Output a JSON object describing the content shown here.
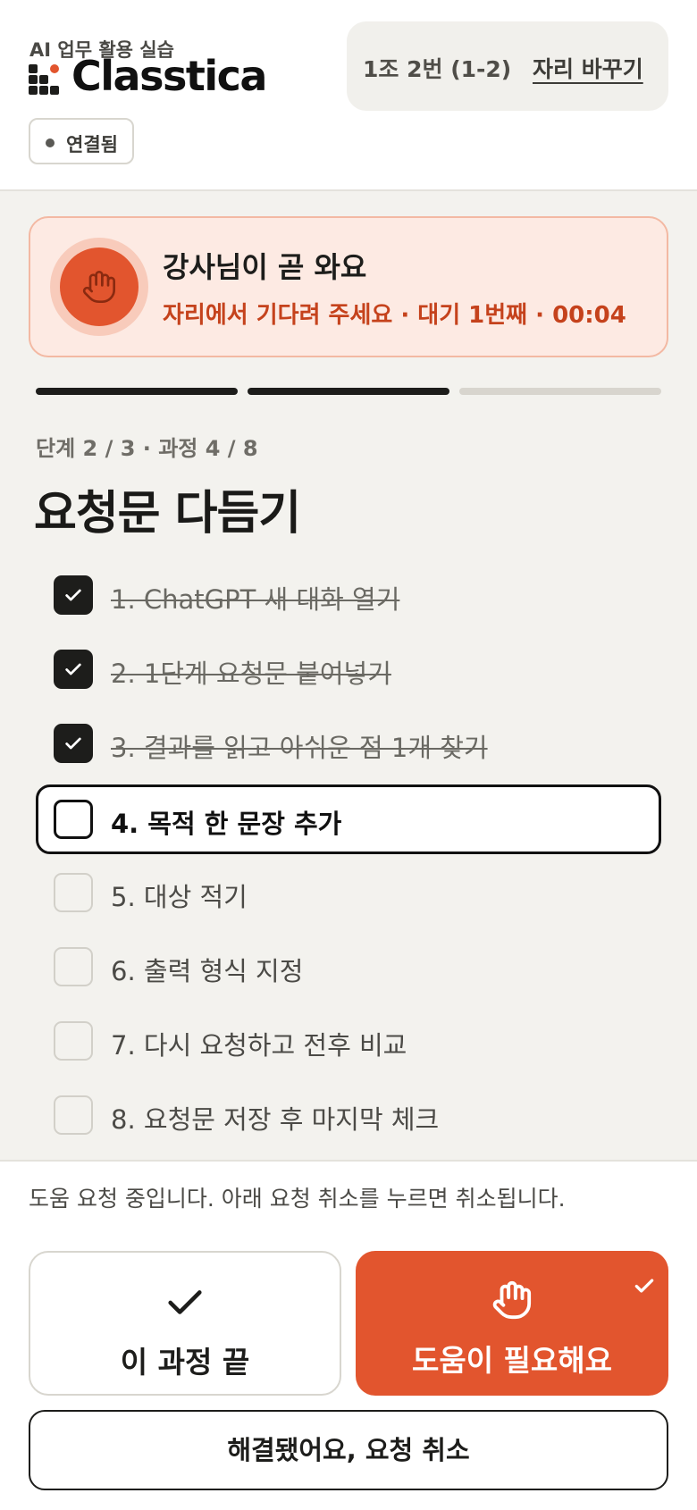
{
  "header": {
    "subtitle": "AI 업무 활용 실습",
    "brand": "Classtica",
    "seat_label": "1조 2번 (1-2)",
    "seat_change": "자리 바꾸기",
    "status_label": "연결됨"
  },
  "alert": {
    "title": "강사님이 곧 와요",
    "subtitle": "자리에서 기다려 주세요 · 대기 1번째 · 00:04",
    "icon": "hand-icon"
  },
  "progress": {
    "total_segments": 3,
    "completed_segments": 2
  },
  "step": {
    "meta": "단계 2 / 3 · 과정 4 / 8",
    "title": "요청문 다듬기"
  },
  "tasks": [
    {
      "label": "1. ChatGPT 새 대화 열기",
      "state": "done"
    },
    {
      "label": "2. 1단계 요청문 붙여넣기",
      "state": "done"
    },
    {
      "label": "3. 결과를 읽고 아쉬운 점 1개 찾기",
      "state": "done"
    },
    {
      "label": "4. 목적 한 문장 추가",
      "state": "current"
    },
    {
      "label": "5. 대상 적기",
      "state": "todo"
    },
    {
      "label": "6. 출력 형식 지정",
      "state": "todo"
    },
    {
      "label": "7. 다시 요청하고 전후 비교",
      "state": "todo"
    },
    {
      "label": "8. 요청문 저장 후 마지막 체크",
      "state": "todo"
    }
  ],
  "footer": {
    "note": "도움 요청 중입니다. 아래 요청 취소를 누르면 취소됩니다.",
    "done_label": "이 과정 끝",
    "help_label": "도움이 필요해요",
    "cancel_label": "해결됐어요, 요청 취소"
  },
  "colors": {
    "accent": "#e2552e",
    "alert_bg": "#fdeae3",
    "alert_text": "#c5421c",
    "dark": "#1d1d1b",
    "background": "#f3f2ee"
  }
}
